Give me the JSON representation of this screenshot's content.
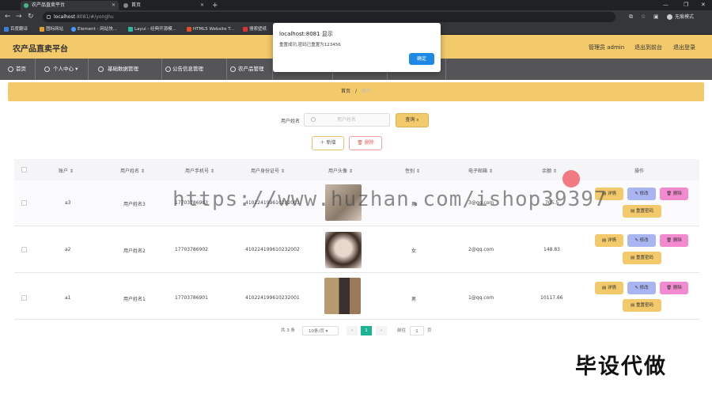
{
  "browser": {
    "tabs": [
      {
        "title": "农产品直卖平台",
        "color": "#41b883"
      },
      {
        "title": "首页",
        "color": "#888888"
      }
    ],
    "url_host": "localhost",
    "url_rest": ":8081/#/yonghu",
    "profile_label": "无痕模式",
    "bookmarks": [
      "百度翻译",
      "图标网站",
      "Element - 网站快...",
      "Layui - 经典开源模...",
      "HTML5 Website T...",
      "搜索壁纸"
    ]
  },
  "dialog": {
    "title": "localhost:8081 显示",
    "message": "重置成功,密码已重置为123456",
    "ok_label": "确定"
  },
  "header": {
    "brand": "农产品直卖平台",
    "admin_label": "管理员 admin",
    "exit_front": "退出到前台",
    "logout": "退出登录"
  },
  "nav": [
    "首页",
    "个人中心",
    "基础数据管理",
    "公告信息管理",
    "农产品管理"
  ],
  "breadcrumb": {
    "home": "首页",
    "sep": "/",
    "current": "用户"
  },
  "search": {
    "label": "用户姓名",
    "placeholder": "用户姓名",
    "query_label": "查询",
    "add_label": "新增",
    "delete_label": "删除"
  },
  "table": {
    "headers": [
      "账户",
      "用户姓名",
      "用户手机号",
      "用户身份证号",
      "用户头像",
      "性别",
      "电子邮箱",
      "余额",
      "操作"
    ],
    "rows": [
      {
        "account": "a3",
        "name": "用户姓名3",
        "phone": "17703786903",
        "idcard": "410224199610232003",
        "gender": "男",
        "email": "3@qq.com",
        "balance": "705.5"
      },
      {
        "account": "a2",
        "name": "用户姓名2",
        "phone": "17703786902",
        "idcard": "410224199610232002",
        "gender": "女",
        "email": "2@qq.com",
        "balance": "148.83"
      },
      {
        "account": "a1",
        "name": "用户姓名1",
        "phone": "17703786901",
        "idcard": "410224199610232001",
        "gender": "男",
        "email": "1@qq.com",
        "balance": "10117.66"
      }
    ],
    "actions": {
      "detail": "详情",
      "edit": "修改",
      "delete": "删除",
      "reset": "重置密码"
    }
  },
  "pagination": {
    "total": "共 3 条",
    "per_page": "10条/页",
    "current": "1",
    "goto_label": "前往",
    "goto_value": "1",
    "page_unit": "页"
  },
  "watermark": "https://www.huzhan.com/ishop39397",
  "bottom_tag": "毕设代做",
  "colors": {
    "header": "#f2c96b",
    "nav": "#555558",
    "detail": "#f2c96b",
    "edit": "#a9b5f0",
    "delete": "#f28ad0",
    "primary": "#1e88e5",
    "page_active": "#1bb394"
  }
}
